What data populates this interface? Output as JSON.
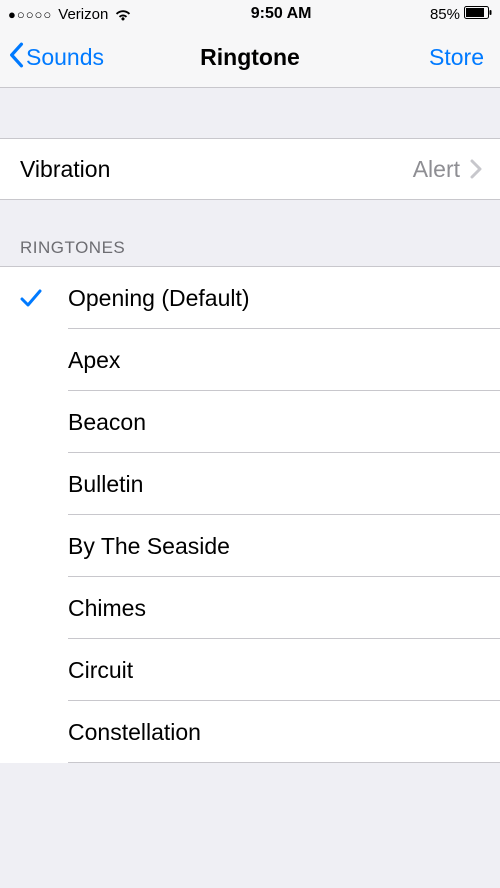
{
  "status": {
    "signal_dots": "●○○○○",
    "carrier": "Verizon",
    "time": "9:50 AM",
    "battery_pct": "85%"
  },
  "nav": {
    "back_label": "Sounds",
    "title": "Ringtone",
    "action_label": "Store"
  },
  "vibration": {
    "label": "Vibration",
    "value": "Alert"
  },
  "section_header": "RINGTONES",
  "ringtones": [
    {
      "label": "Opening (Default)",
      "selected": true
    },
    {
      "label": "Apex",
      "selected": false
    },
    {
      "label": "Beacon",
      "selected": false
    },
    {
      "label": "Bulletin",
      "selected": false
    },
    {
      "label": "By The Seaside",
      "selected": false
    },
    {
      "label": "Chimes",
      "selected": false
    },
    {
      "label": "Circuit",
      "selected": false
    },
    {
      "label": "Constellation",
      "selected": false
    }
  ]
}
